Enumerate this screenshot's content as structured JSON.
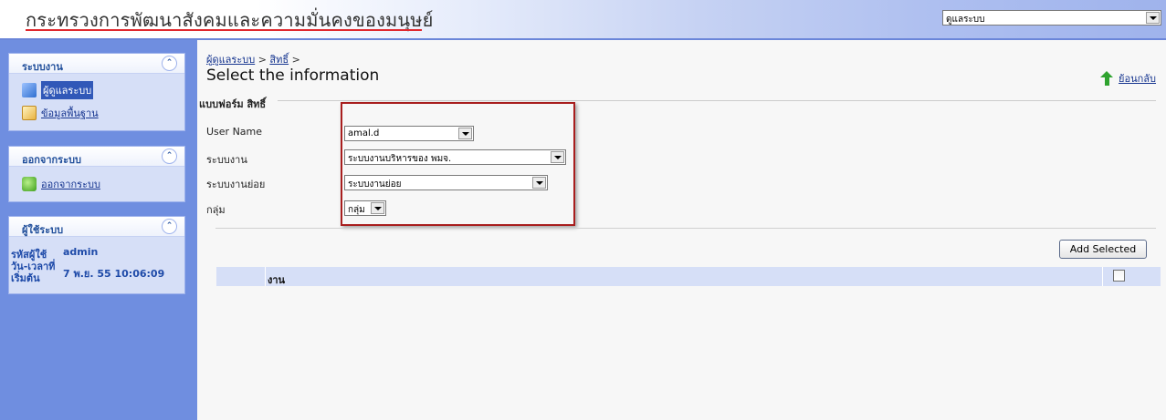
{
  "header": {
    "title": "กระทรวงการพัฒนาสังคมและความมั่นคงของมนุษย์",
    "system_select_value": "ดูแลระบบ"
  },
  "sidebar": {
    "panel_system": {
      "title": "ระบบงาน",
      "items": [
        {
          "label": "ผู้ดูแลระบบ",
          "icon": "users-icon"
        },
        {
          "label": "ข้อมูลพื้นฐาน",
          "icon": "data-icon"
        }
      ]
    },
    "panel_logout": {
      "title": "ออกจากระบบ",
      "items": [
        {
          "label": "ออกจากระบบ",
          "icon": "exit-icon"
        }
      ]
    },
    "panel_user": {
      "title": "ผู้ใช้ระบบ",
      "user_id_label": "รหัสผู้ใช้",
      "user_id_value": "admin",
      "login_label_1": "วัน-เวลาที่",
      "login_label_2": "เริ่มต้น",
      "login_value": "7 พ.ย. 55 10:06:09"
    }
  },
  "main": {
    "breadcrumb": {
      "link1": "ผู้ดูแลระบบ",
      "sep1": " > ",
      "link2": "สิทธิ์",
      "sep2": " >"
    },
    "title": "Select the information",
    "back_label": "ย้อนกลับ",
    "form": {
      "legend": "แบบฟอร์ม สิทธิ์",
      "username_label": "User Name",
      "username_value": "amal.d",
      "system_label": "ระบบงาน",
      "system_value": "ระบบงานบริหารของ พมจ.",
      "subsystem_label": "ระบบงานย่อย",
      "subsystem_value": "ระบบงานย่อย",
      "group_label": "กลุ่ม",
      "group_value": "กลุ่ม"
    },
    "add_button": "Add Selected",
    "grid": {
      "column_task": "งาน"
    }
  },
  "colors": {
    "sidebar_bg": "#6f8ee0",
    "panel_bg": "#d6dff7",
    "highlight_box": "#a81e1e",
    "title_underline": "#e0282e"
  }
}
